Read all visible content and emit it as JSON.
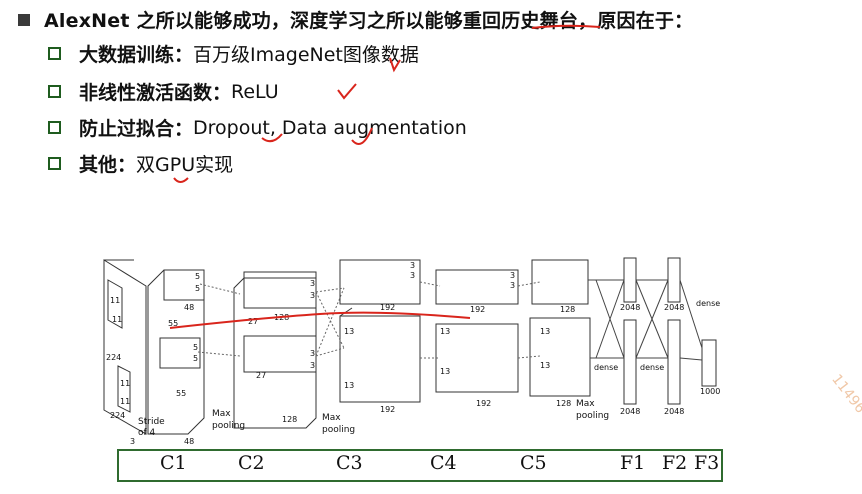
{
  "headline": "AlexNet 之所以能够成功，深度学习之所以能够重回历史舞台，原因在于：",
  "items": [
    {
      "label": "大数据训练：",
      "value": "百万级ImageNet图像数据"
    },
    {
      "label": "非线性激活函数：",
      "value": "ReLU"
    },
    {
      "label": "防止过拟合：",
      "value": "Dropout, Data augmentation"
    },
    {
      "label": "其他：",
      "value": "双GPU实现"
    }
  ],
  "diagram": {
    "input": {
      "size": "224",
      "kernel": "11",
      "stride": "Stride\nof 4",
      "channels": "3"
    },
    "conv1": {
      "size": "55",
      "depth": "48",
      "kernel": "5"
    },
    "conv2": {
      "size": "27",
      "depth": "128",
      "kernel": "3"
    },
    "conv3": {
      "size": "13",
      "depth": "192",
      "kernel": "3"
    },
    "conv4": {
      "size": "13",
      "depth": "192",
      "kernel": "3"
    },
    "conv5": {
      "size": "13",
      "depth": "128"
    },
    "pool": "Max\npooling",
    "fc": {
      "f1": "2048",
      "f2": "2048",
      "out": "1000",
      "dense": "dense"
    }
  },
  "layer_labels": [
    "C1",
    "C2",
    "C3",
    "C4",
    "C5",
    "F1",
    "F2",
    "F3"
  ],
  "watermark": "11496",
  "colors": {
    "annotation": "#d9251c",
    "green_square": "#1f5c1f",
    "box_border": "#2f6b2f"
  }
}
